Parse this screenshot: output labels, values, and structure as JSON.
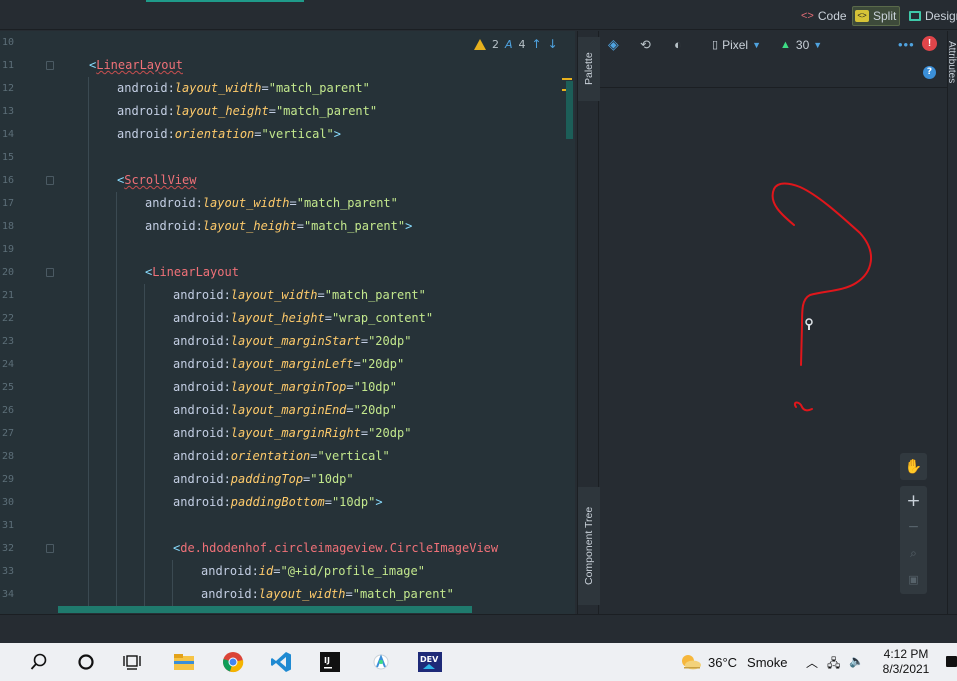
{
  "top_bar": {
    "view_modes": [
      {
        "label": "Code",
        "icon": "code-icon"
      },
      {
        "label": "Split",
        "icon": "split-icon"
      },
      {
        "label": "Design",
        "icon": "design-icon"
      }
    ]
  },
  "editor": {
    "warnings_count": "2",
    "weak_warnings_count": "4",
    "lines": [
      {
        "num": "10",
        "indent": 0,
        "parts": []
      },
      {
        "num": "11",
        "indent": 3,
        "fold": true,
        "parts": [
          [
            "br",
            "<"
          ],
          [
            "tag wavy",
            "LinearLayout"
          ]
        ]
      },
      {
        "num": "12",
        "indent": 4,
        "parts": [
          [
            "ns",
            "android:"
          ],
          [
            "attr",
            "layout_width"
          ],
          [
            "ns",
            "="
          ],
          [
            "val",
            "\"match_parent\""
          ]
        ]
      },
      {
        "num": "13",
        "indent": 4,
        "parts": [
          [
            "ns",
            "android:"
          ],
          [
            "attr",
            "layout_height"
          ],
          [
            "ns",
            "="
          ],
          [
            "val",
            "\"match_parent\""
          ]
        ]
      },
      {
        "num": "14",
        "indent": 4,
        "parts": [
          [
            "ns",
            "android:"
          ],
          [
            "attr",
            "orientation"
          ],
          [
            "ns",
            "="
          ],
          [
            "val",
            "\"vertical\""
          ],
          [
            "br",
            ">"
          ]
        ]
      },
      {
        "num": "15",
        "indent": 4,
        "parts": []
      },
      {
        "num": "16",
        "indent": 4,
        "fold": true,
        "parts": [
          [
            "br",
            "<"
          ],
          [
            "tag wavy",
            "ScrollView"
          ]
        ]
      },
      {
        "num": "17",
        "indent": 5,
        "parts": [
          [
            "ns",
            "android:"
          ],
          [
            "attr",
            "layout_width"
          ],
          [
            "ns",
            "="
          ],
          [
            "val",
            "\"match_parent\""
          ]
        ]
      },
      {
        "num": "18",
        "indent": 5,
        "parts": [
          [
            "ns",
            "android:"
          ],
          [
            "attr",
            "layout_height"
          ],
          [
            "ns",
            "="
          ],
          [
            "val",
            "\"match_parent\""
          ],
          [
            "br",
            ">"
          ]
        ]
      },
      {
        "num": "19",
        "indent": 5,
        "parts": []
      },
      {
        "num": "20",
        "indent": 5,
        "fold": true,
        "parts": [
          [
            "br",
            "<"
          ],
          [
            "tag",
            "LinearLayout"
          ]
        ]
      },
      {
        "num": "21",
        "indent": 6,
        "parts": [
          [
            "ns",
            "android:"
          ],
          [
            "attr",
            "layout_width"
          ],
          [
            "ns",
            "="
          ],
          [
            "val",
            "\"match_parent\""
          ]
        ]
      },
      {
        "num": "22",
        "indent": 6,
        "parts": [
          [
            "ns",
            "android:"
          ],
          [
            "attr",
            "layout_height"
          ],
          [
            "ns",
            "="
          ],
          [
            "val",
            "\"wrap_content\""
          ]
        ]
      },
      {
        "num": "23",
        "indent": 6,
        "parts": [
          [
            "ns",
            "android:"
          ],
          [
            "attr",
            "layout_marginStart"
          ],
          [
            "ns",
            "="
          ],
          [
            "val",
            "\"20dp\""
          ]
        ]
      },
      {
        "num": "24",
        "indent": 6,
        "parts": [
          [
            "ns",
            "android:"
          ],
          [
            "attr",
            "layout_marginLeft"
          ],
          [
            "ns",
            "="
          ],
          [
            "val",
            "\"20dp\""
          ]
        ]
      },
      {
        "num": "25",
        "indent": 6,
        "parts": [
          [
            "ns",
            "android:"
          ],
          [
            "attr",
            "layout_marginTop"
          ],
          [
            "ns",
            "="
          ],
          [
            "val",
            "\"10dp\""
          ]
        ]
      },
      {
        "num": "26",
        "indent": 6,
        "parts": [
          [
            "ns",
            "android:"
          ],
          [
            "attr",
            "layout_marginEnd"
          ],
          [
            "ns",
            "="
          ],
          [
            "val",
            "\"20dp\""
          ]
        ]
      },
      {
        "num": "27",
        "indent": 6,
        "parts": [
          [
            "ns",
            "android:"
          ],
          [
            "attr",
            "layout_marginRight"
          ],
          [
            "ns",
            "="
          ],
          [
            "val",
            "\"20dp\""
          ]
        ]
      },
      {
        "num": "28",
        "indent": 6,
        "parts": [
          [
            "ns",
            "android:"
          ],
          [
            "attr",
            "orientation"
          ],
          [
            "ns",
            "="
          ],
          [
            "val",
            "\"vertical\""
          ]
        ]
      },
      {
        "num": "29",
        "indent": 6,
        "parts": [
          [
            "ns",
            "android:"
          ],
          [
            "attr",
            "paddingTop"
          ],
          [
            "ns",
            "="
          ],
          [
            "val",
            "\"10dp\""
          ]
        ]
      },
      {
        "num": "30",
        "indent": 6,
        "parts": [
          [
            "ns",
            "android:"
          ],
          [
            "attr",
            "paddingBottom"
          ],
          [
            "ns",
            "="
          ],
          [
            "val",
            "\"10dp\""
          ],
          [
            "br",
            ">"
          ]
        ]
      },
      {
        "num": "31",
        "indent": 6,
        "parts": []
      },
      {
        "num": "32",
        "indent": 6,
        "fold": true,
        "parts": [
          [
            "br",
            "<"
          ],
          [
            "tag",
            "de.hdodenhof.circleimageview.CircleImageView"
          ]
        ]
      },
      {
        "num": "33",
        "indent": 7,
        "parts": [
          [
            "ns",
            "android:"
          ],
          [
            "attr",
            "id"
          ],
          [
            "ns",
            "="
          ],
          [
            "val",
            "\"@+id/profile_image\""
          ]
        ]
      },
      {
        "num": "34",
        "indent": 7,
        "parts": [
          [
            "ns",
            "android:"
          ],
          [
            "attr",
            "layout_width"
          ],
          [
            "ns",
            "="
          ],
          [
            "val",
            "\"match_parent\""
          ]
        ]
      }
    ]
  },
  "side_tabs": {
    "palette": "Palette",
    "component_tree": "Component Tree",
    "attributes": "Attributes"
  },
  "design_toolbar": {
    "device": "Pixel",
    "api_level": "30"
  },
  "taskbar": {
    "weather_temp": "36°C",
    "weather_desc": "Smoke",
    "time": "4:12 PM",
    "date": "8/3/2021"
  },
  "colors": {
    "accent": "#1f9b8a",
    "scribble": "#e0161b",
    "error": "#e0454a",
    "warning": "#e7b11e"
  }
}
